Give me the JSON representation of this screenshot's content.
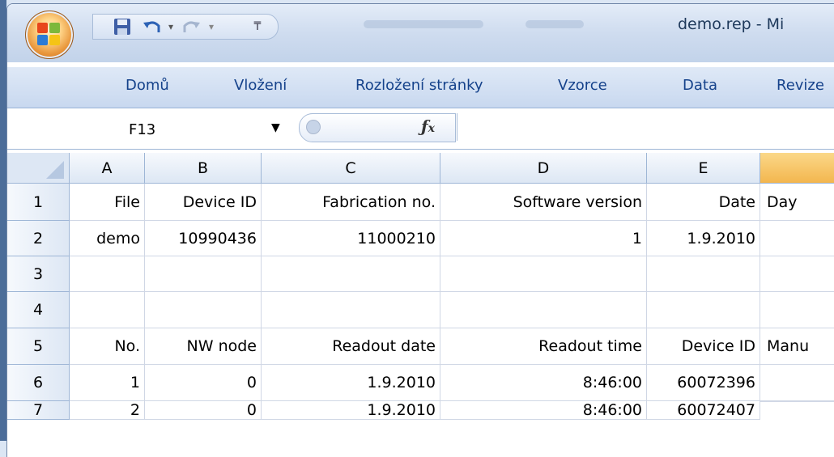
{
  "window": {
    "doc_title": "demo.rep - Mi"
  },
  "ribbon": {
    "tabs": [
      {
        "label": "Domů"
      },
      {
        "label": "Vložení"
      },
      {
        "label": "Rozložení stránky"
      },
      {
        "label": "Vzorce"
      },
      {
        "label": "Data"
      },
      {
        "label": "Revize"
      }
    ]
  },
  "formula_bar": {
    "name_box": "F13",
    "fx_label": "fx",
    "value": ""
  },
  "sheet": {
    "columns": [
      "A",
      "B",
      "C",
      "D",
      "E",
      ""
    ],
    "rows": [
      {
        "n": "1",
        "cells": [
          "File",
          "Device ID",
          "Fabrication no.",
          "Software version",
          "Date",
          "Day"
        ]
      },
      {
        "n": "2",
        "cells": [
          "demo",
          "10990436",
          "11000210",
          "1",
          "1.9.2010",
          ""
        ]
      },
      {
        "n": "3",
        "cells": [
          "",
          "",
          "",
          "",
          "",
          ""
        ]
      },
      {
        "n": "4",
        "cells": [
          "",
          "",
          "",
          "",
          "",
          ""
        ]
      },
      {
        "n": "5",
        "cells": [
          "No.",
          "NW node",
          "Readout date",
          "Readout time",
          "Device ID",
          "Manu"
        ]
      },
      {
        "n": "6",
        "cells": [
          "1",
          "0",
          "1.9.2010",
          "8:46:00",
          "60072396",
          ""
        ]
      },
      {
        "n": "7",
        "cells": [
          "2",
          "0",
          "1.9.2010",
          "8:46:00",
          "60072407",
          ""
        ]
      }
    ]
  },
  "colors": {
    "selected_column": "#f3b64e",
    "header_text": "#15428b"
  },
  "icons": {
    "office_button": "office-logo-icon",
    "save": "save-icon",
    "undo": "undo-icon",
    "redo": "redo-icon",
    "customize": "customize-qat-icon"
  }
}
